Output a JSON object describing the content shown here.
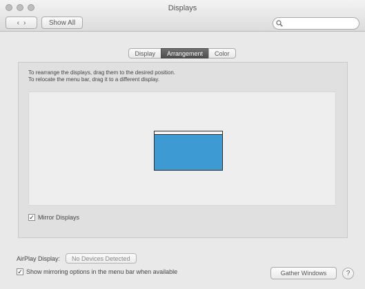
{
  "window": {
    "title": "Displays"
  },
  "toolbar": {
    "back_glyph": "‹",
    "forward_glyph": "›",
    "show_all_label": "Show All",
    "search_placeholder": "",
    "search_icon": "magnifier-icon"
  },
  "tabs": [
    {
      "label": "Display",
      "active": false
    },
    {
      "label": "Arrangement",
      "active": true
    },
    {
      "label": "Color",
      "active": false
    }
  ],
  "arrangement": {
    "instruction_line1": "To rearrange the displays, drag them to the desired position.",
    "instruction_line2": "To relocate the menu bar, drag it to a different display.",
    "mirror_label": "Mirror Displays",
    "mirror_checked": true,
    "display_color": "#3d9ad3"
  },
  "bottom": {
    "airplay_label": "AirPlay Display:",
    "airplay_value": "No Devices Detected",
    "menubar_label": "Show mirroring options in the menu bar when available",
    "menubar_checked": true,
    "gather_label": "Gather Windows",
    "help_glyph": "?"
  }
}
